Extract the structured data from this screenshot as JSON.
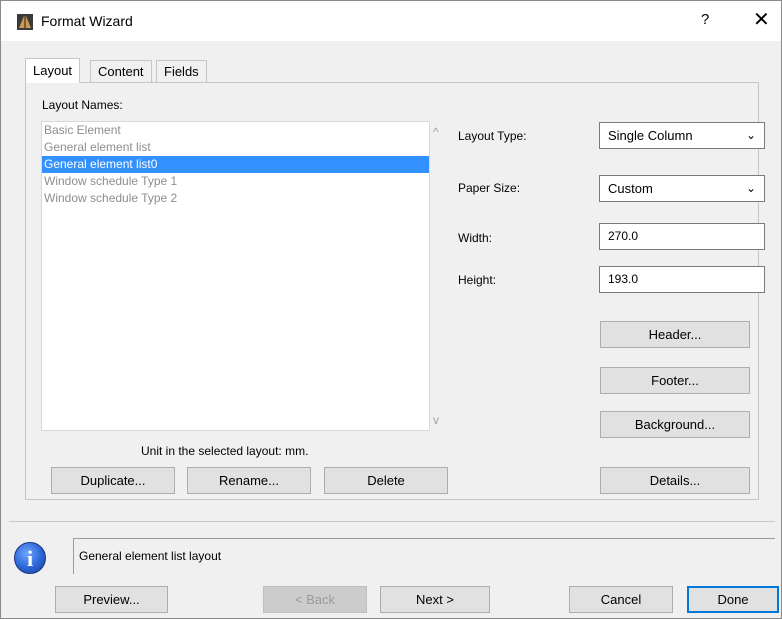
{
  "window": {
    "title": "Format Wizard",
    "help_label": "?",
    "close_label": "✕"
  },
  "tabs": [
    {
      "label": "Layout",
      "active": true
    },
    {
      "label": "Content",
      "active": false
    },
    {
      "label": "Fields",
      "active": false
    }
  ],
  "layout_list": {
    "label": "Layout Names:",
    "items": [
      {
        "label": "Basic Element",
        "selected": false
      },
      {
        "label": "General element list",
        "selected": false
      },
      {
        "label": "General element list0",
        "selected": true
      },
      {
        "label": "Window schedule Type 1",
        "selected": false
      },
      {
        "label": "Window schedule Type 2",
        "selected": false
      }
    ],
    "unit_text": "Unit in the selected layout: mm."
  },
  "list_buttons": {
    "duplicate": "Duplicate...",
    "rename": "Rename...",
    "delete": "Delete"
  },
  "settings": {
    "layout_type_label": "Layout Type:",
    "layout_type_value": "Single Column",
    "paper_size_label": "Paper Size:",
    "paper_size_value": "Custom",
    "width_label": "Width:",
    "width_value": "270.0",
    "height_label": "Height:",
    "height_value": "193.0"
  },
  "side_buttons": {
    "header": "Header...",
    "footer": "Footer...",
    "background": "Background...",
    "details": "Details..."
  },
  "status": {
    "info_glyph": "i",
    "text": "General element list layout"
  },
  "footer_buttons": {
    "preview": "Preview...",
    "back": "< Back",
    "next": "Next >",
    "cancel": "Cancel",
    "done": "Done"
  },
  "colors": {
    "selection": "#3390ff",
    "default_button_border": "#0078d7"
  },
  "icons": {
    "app": "format-wizard-app-icon",
    "dropdown": "chevron-down-icon",
    "info": "info-icon"
  }
}
